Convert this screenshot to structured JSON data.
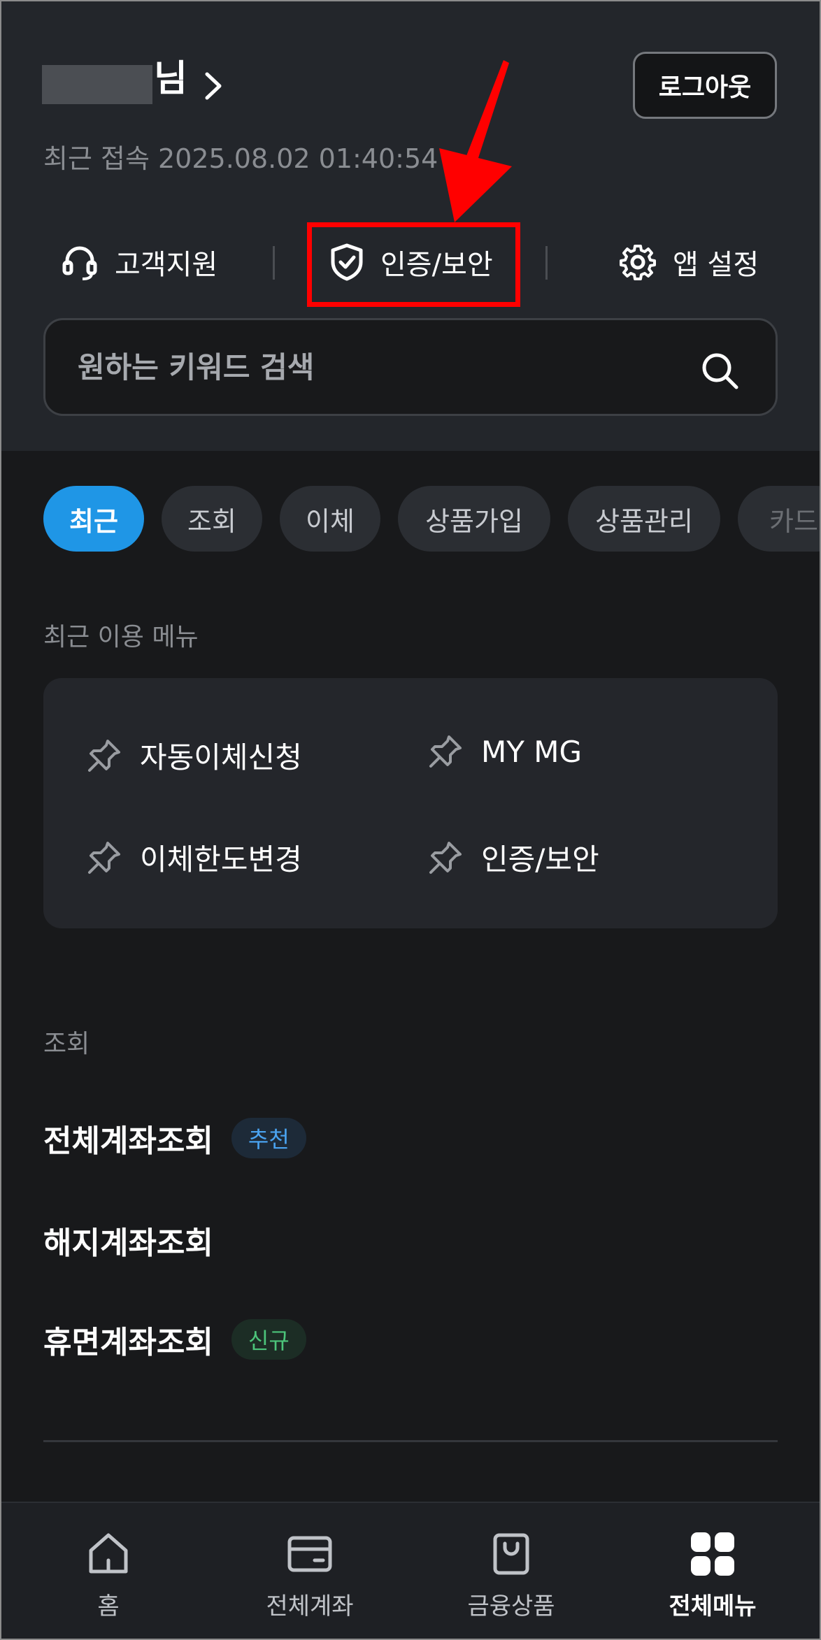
{
  "header": {
    "user_suffix": "님",
    "last_access": "최근 접속 2025.08.02 01:40:54",
    "logout_label": "로그아웃",
    "quick_links": [
      {
        "label": "고객지원",
        "icon": "headset-icon"
      },
      {
        "label": "인증/보안",
        "icon": "shield-check-icon"
      },
      {
        "label": "앱 설정",
        "icon": "gear-icon"
      }
    ]
  },
  "search": {
    "placeholder": "원하는 키워드 검색",
    "icon": "search-icon"
  },
  "tabs": [
    "최근",
    "조회",
    "이체",
    "상품가입",
    "상품관리",
    "카드"
  ],
  "active_tab": "최근",
  "recent": {
    "title": "최근 이용 메뉴",
    "items": [
      "자동이체신청",
      "MY MG",
      "이체한도변경",
      "인증/보안"
    ],
    "icon": "pin-icon"
  },
  "inquiry": {
    "title": "조회",
    "items": [
      {
        "label": "전체계좌조회",
        "badge": "추천"
      },
      {
        "label": "해지계좌조회",
        "badge": ""
      },
      {
        "label": "휴면계좌조회",
        "badge": "신규"
      }
    ]
  },
  "bottom_nav": [
    {
      "label": "홈",
      "icon": "home-icon"
    },
    {
      "label": "전체계좌",
      "icon": "wallet-icon"
    },
    {
      "label": "금융상품",
      "icon": "shopping-bag-icon"
    },
    {
      "label": "전체메뉴",
      "icon": "grid-icon"
    }
  ],
  "colors": {
    "accent": "#1f96e6",
    "highlight": "#ff0000",
    "badge_blue": "#4aa3f0",
    "badge_green": "#4cc47a"
  }
}
